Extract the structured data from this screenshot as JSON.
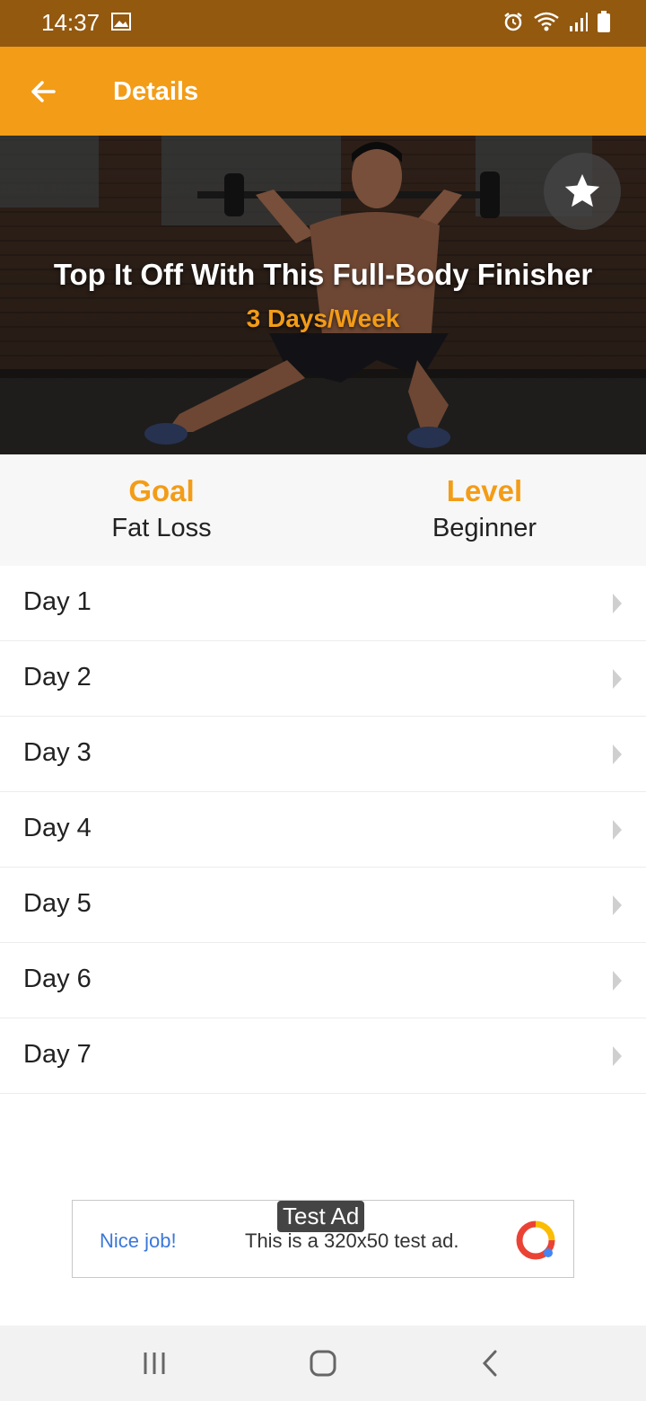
{
  "status_bar": {
    "time": "14:37",
    "background": "#93590f"
  },
  "app_bar": {
    "title": "Details",
    "background": "#f39c17",
    "back_icon": "arrow-left-icon"
  },
  "hero": {
    "title": "Top It Off With This Full-Body Finisher",
    "subtitle": "3 Days/Week",
    "favorite_icon": "star-icon"
  },
  "info": {
    "goal_label": "Goal",
    "goal_value": "Fat Loss",
    "level_label": "Level",
    "level_value": "Beginner"
  },
  "days": [
    {
      "label": "Day 1"
    },
    {
      "label": "Day 2"
    },
    {
      "label": "Day 3"
    },
    {
      "label": "Day 4"
    },
    {
      "label": "Day 5"
    },
    {
      "label": "Day 6"
    },
    {
      "label": "Day 7"
    }
  ],
  "ad": {
    "tag": "Test Ad",
    "cta": "Nice job!",
    "text": "This is a 320x50 test ad."
  },
  "accent_color": "#f39c17",
  "nav_icons": [
    "recent-apps-icon",
    "home-icon",
    "back-chevron-icon"
  ]
}
